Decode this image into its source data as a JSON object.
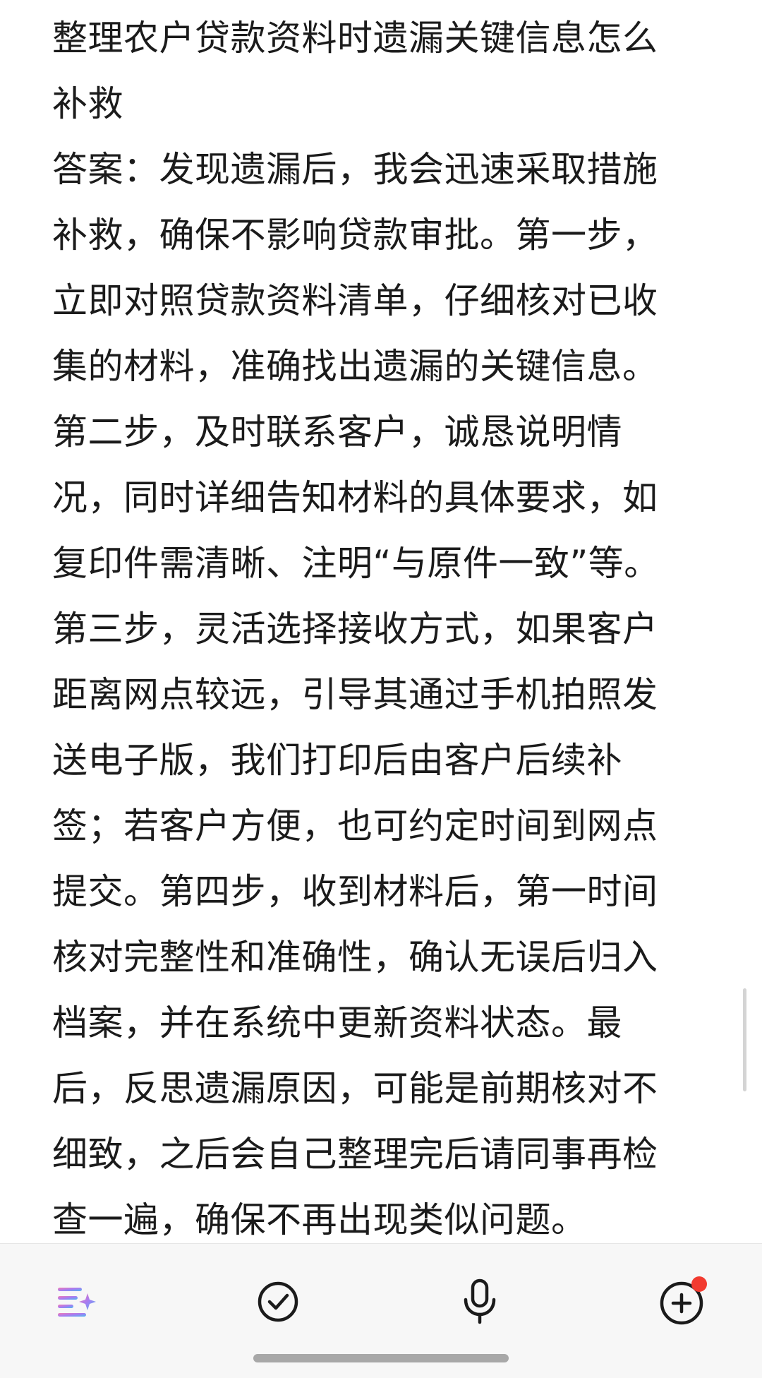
{
  "note": {
    "lines": [
      "整理农户贷款资料时遗漏关键信息怎么",
      "补救",
      "答案：发现遗漏后，我会迅速采取措施",
      "补救，确保不影响贷款审批。第一步，",
      "立即对照贷款资料清单，仔细核对已收",
      "集的材料，准确找出遗漏的关键信息。",
      "第二步，及时联系客户，诚恳说明情",
      "况，同时详细告知材料的具体要求，如",
      "复印件需清晰、注明“与原件一致”等。",
      "第三步，灵活选择接收方式，如果客户",
      "距离网点较远，引导其通过手机拍照发",
      "送电子版，我们打印后由客户后续补",
      "签；若客户方便，也可约定时间到网点",
      "提交。第四步，收到材料后，第一时间",
      "核对完整性和准确性，确认无误后归入",
      "档案，并在系统中更新资料状态。最",
      "后，反思遗漏原因，可能是前期核对不",
      "细致，之后会自己整理完后请同事再检",
      "查一遍，确保不再出现类似问题。"
    ]
  },
  "toolbar": {
    "items": [
      {
        "name": "ai-format-icon"
      },
      {
        "name": "checklist-icon"
      },
      {
        "name": "microphone-icon"
      },
      {
        "name": "add-icon"
      }
    ],
    "badge_color": "#f23b30"
  }
}
